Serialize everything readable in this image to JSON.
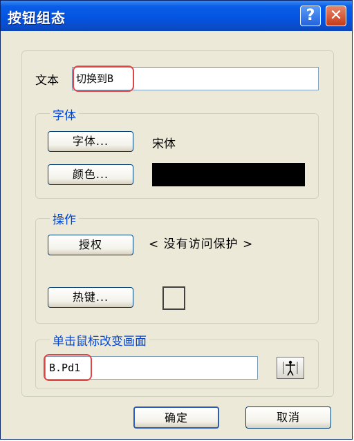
{
  "window": {
    "title": "按钮组态"
  },
  "titlebar": {
    "help_label": "?",
    "close_label": "✕"
  },
  "text_field": {
    "label": "文本",
    "value": "切换到B"
  },
  "font_group": {
    "title": "字体",
    "font_button": "字体...",
    "font_value": "宋体",
    "color_button": "颜色...",
    "color_value": "#000000"
  },
  "operation_group": {
    "title": "操作",
    "authorize_button": "授权",
    "authorize_status": "< 没有访问保护 >",
    "hotkey_button": "热键..."
  },
  "screen_group": {
    "title": "单击鼠标改变画面",
    "value": "B.Pd1",
    "browse_icon": "picture-select-icon"
  },
  "footer": {
    "ok_button": "确定",
    "cancel_button": "取消"
  },
  "colors": {
    "title_bar": "#0454e2",
    "group_title": "#0046d5",
    "highlight": "#e04545",
    "dialog_bg": "#ece9d8"
  }
}
